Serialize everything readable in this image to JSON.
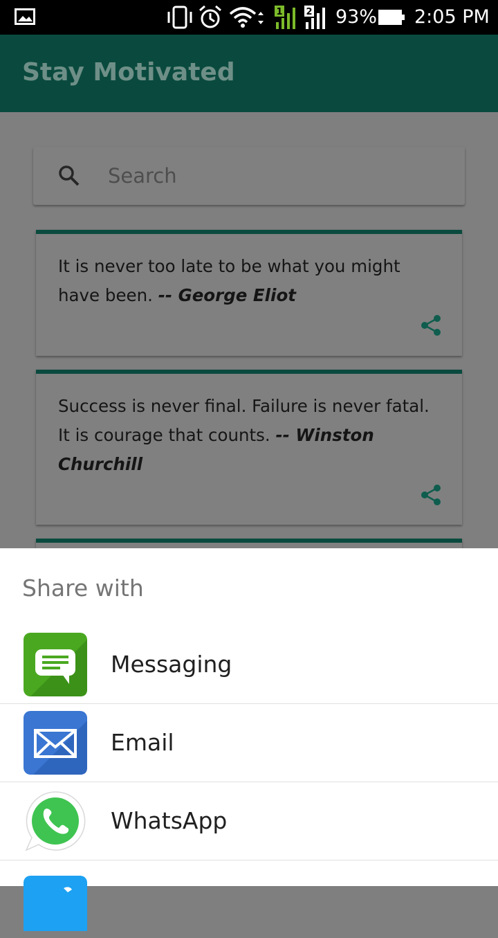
{
  "status_bar": {
    "battery_percent": "93%",
    "time": "2:05 PM",
    "sim1_label": "1",
    "sim2_label": "2",
    "icons": [
      "gallery-icon",
      "vibrate-icon",
      "alarm-icon",
      "wifi-icon",
      "signal-sim1-icon",
      "signal-sim2-icon",
      "battery-icon"
    ]
  },
  "app_bar": {
    "title": "Stay Motivated"
  },
  "search": {
    "placeholder": "Search",
    "value": ""
  },
  "quotes": [
    {
      "text": "It is never too late to be what you might have been.",
      "author": "-- George Eliot"
    },
    {
      "text": "Success is never final. Failure is never fatal. It is courage that counts.",
      "author": "-- Winston Churchill"
    }
  ],
  "share_sheet": {
    "title": "Share with",
    "apps": [
      {
        "label": "Messaging",
        "icon": "messaging-icon"
      },
      {
        "label": "Email",
        "icon": "email-icon"
      },
      {
        "label": "WhatsApp",
        "icon": "whatsapp-icon"
      },
      {
        "label": "",
        "icon": "twitter-icon"
      }
    ]
  },
  "colors": {
    "app_bar": "#0a4a3e",
    "accent": "#0f6e5c",
    "scrim": "#7f7f7f",
    "sheet": "#ffffff"
  }
}
